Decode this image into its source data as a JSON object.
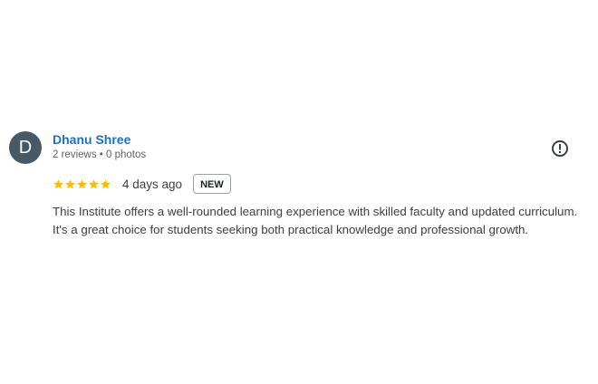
{
  "review": {
    "avatar_letter": "D",
    "author_name": "Dhanu Shree",
    "author_meta": "2 reviews • 0 photos",
    "rating": 5,
    "rating_max": 5,
    "date": "4 days ago",
    "badge": "NEW",
    "text": "This Institute offers a well-rounded learning experience with skilled faculty and updated curriculum. It's a great choice for students seeking both practical knowledge and professional growth.",
    "report_icon": "exclamation-circle-icon",
    "star_icon": "star-icon"
  },
  "colors": {
    "avatar_bg": "#455a64",
    "author_link": "#1f6fc5",
    "star": "#fbbc04",
    "text": "#3c4043",
    "muted": "#5f6368"
  }
}
